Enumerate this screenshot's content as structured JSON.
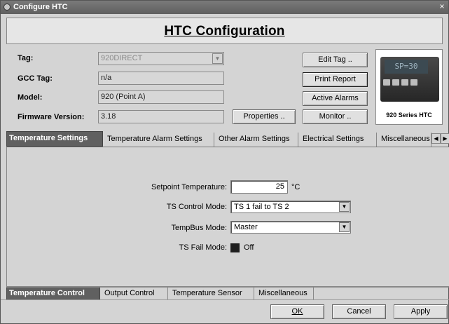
{
  "window": {
    "title": "Configure HTC",
    "close_glyph": "×"
  },
  "header": {
    "title": "HTC Configuration"
  },
  "info": {
    "tag_label": "Tag:",
    "tag_value": "920DIRECT",
    "gcc_label": "GCC Tag:",
    "gcc_value": "n/a",
    "model_label": "Model:",
    "model_value": "920 (Point A)",
    "firmware_label": "Firmware Version:",
    "firmware_value": "3.18"
  },
  "buttons": {
    "properties": "Properties ..",
    "edit_tag": "Edit Tag ..",
    "print_report": "Print Report",
    "active_alarms": "Active Alarms",
    "monitor": "Monitor ..",
    "ok": "OK",
    "cancel": "Cancel",
    "apply": "Apply"
  },
  "device": {
    "display": "SP=30",
    "caption": "920 Series HTC"
  },
  "tabs_top": [
    "Temperature Settings",
    "Temperature Alarm Settings",
    "Other Alarm Settings",
    "Electrical Settings",
    "Miscellaneous"
  ],
  "settings": {
    "setpoint_label": "Setpoint Temperature:",
    "setpoint_value": "25",
    "setpoint_unit": "°C",
    "ts_control_label": "TS Control Mode:",
    "ts_control_value": "TS 1 fail to TS 2",
    "tempbus_label": "TempBus Mode:",
    "tempbus_value": "Master",
    "ts_fail_label": "TS Fail Mode:",
    "ts_fail_value": "Off"
  },
  "tabs_bottom": [
    "Temperature Control",
    "Output Control",
    "Temperature Sensor",
    "Miscellaneous"
  ],
  "icons": {
    "app": "app-icon",
    "close": "close-icon",
    "combo": "chevron-down-icon",
    "scroll_left": "chevron-left-icon",
    "scroll_right": "chevron-right-icon"
  },
  "colors": {
    "active_tab_bg": "#606060",
    "title_bar": "#6b6b6b",
    "window_bg": "#d4d4d4"
  }
}
